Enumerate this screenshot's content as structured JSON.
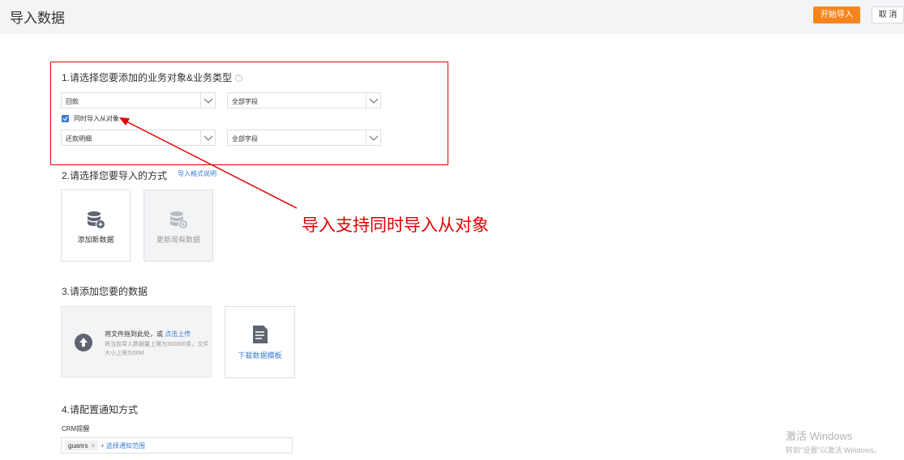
{
  "header": {
    "title": "导入数据",
    "start_label": "开始导入",
    "cancel_label": "取 消"
  },
  "step1": {
    "title": "1.请选择您要添加的业务对象&业务类型",
    "help": "?",
    "object_select": "回款",
    "type_select": "全部字段",
    "checkbox_label": "同时导入从对象",
    "checkbox_checked": true,
    "sub_object_select": "还款明细",
    "sub_type_select": "全部字段"
  },
  "step2": {
    "title": "2.请选择您要导入的方式",
    "format_link": "导入格式说明",
    "add_card": "添加新数据",
    "update_card": "更新现有数据"
  },
  "step3": {
    "title": "3.请添加您要的数据",
    "upload_text": "将文件拖到此处，或",
    "upload_link": "点击上传",
    "upload_hint": "将当前导入数据量上限为300000条，文件大小上限为50M",
    "template_label": "下载数据模板"
  },
  "step4": {
    "title": "4.请配置通知方式",
    "crm_label": "CRM提醒",
    "tag": "guanrs",
    "tag_remove": "×",
    "add_scope": "+ 选择通知范围"
  },
  "annotation": "导入支持同时导入从对象",
  "watermark": {
    "line1": "激活 Windows",
    "line2": "转到\"设置\"以激活 Windows。"
  },
  "colors": {
    "accent": "#f7851f",
    "link": "#3a7bd5",
    "annotation": "#e00000"
  }
}
